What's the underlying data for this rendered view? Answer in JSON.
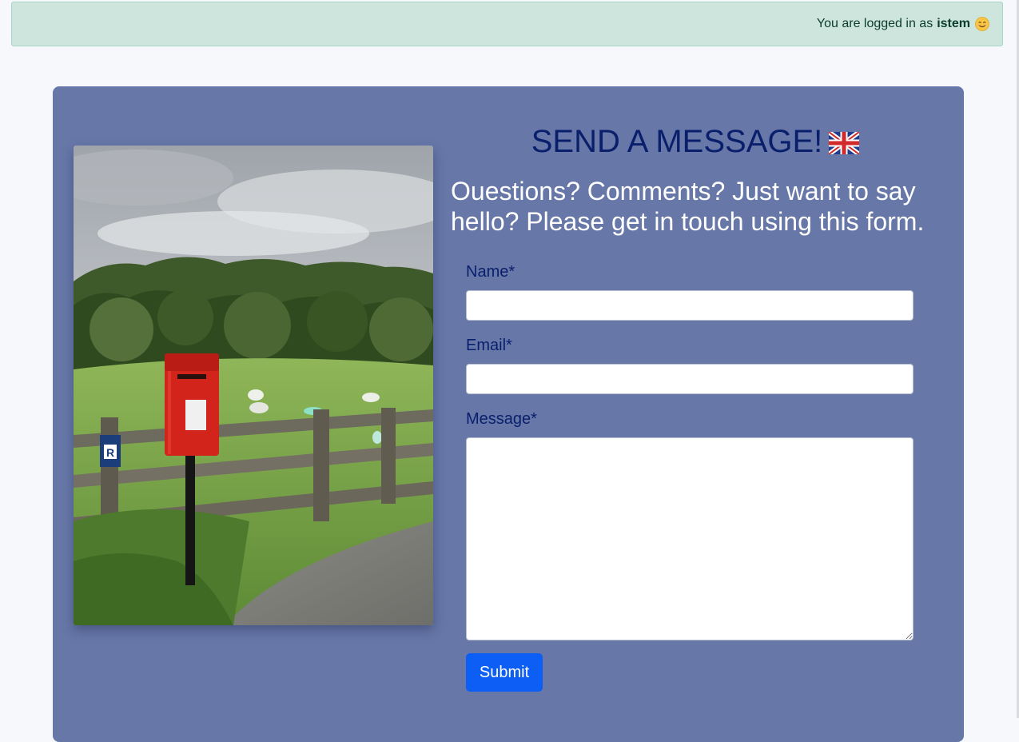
{
  "banner": {
    "prefix": "You are logged in as",
    "username": "istem",
    "emoji_icon": "smiling-face-icon"
  },
  "contact": {
    "heading": "SEND A MESSAGE!",
    "heading_icon": "uk-flag-icon",
    "intro": "Ouestions? Comments? Just want to say hello? Please get in touch using this form.",
    "photo_description_icon": "post-box-photo",
    "fields": {
      "name_label": "Name*",
      "name_value": "",
      "email_label": "Email*",
      "email_value": "",
      "message_label": "Message*",
      "message_value": ""
    },
    "submit_label": "Submit"
  },
  "colors": {
    "card_bg": "#6677a8",
    "heading": "#0a1f6b",
    "banner_bg": "#cde5dc",
    "submit_bg": "#0d5ef5"
  }
}
